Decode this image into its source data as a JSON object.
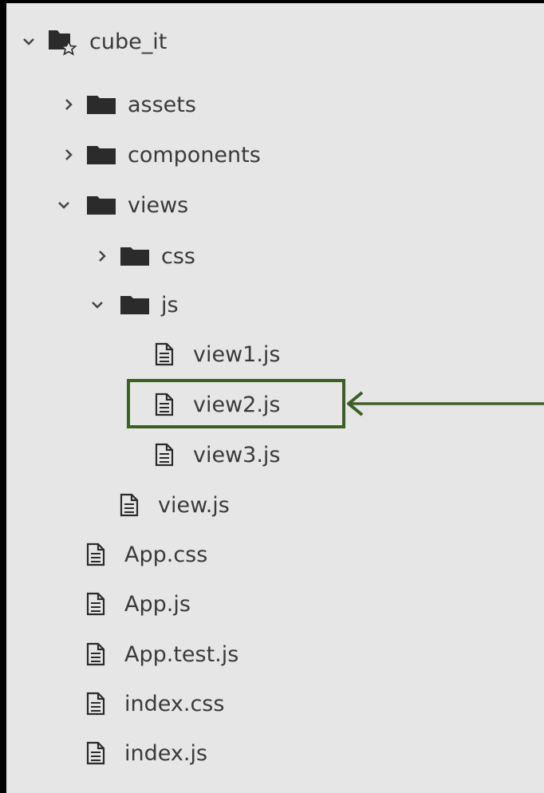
{
  "tree": {
    "root": {
      "label": "cube_it",
      "icon": "project-folder-icon",
      "expanded": true
    },
    "items": [
      {
        "label": "assets",
        "type": "folder",
        "expanded": false
      },
      {
        "label": "components",
        "type": "folder",
        "expanded": false
      },
      {
        "label": "views",
        "type": "folder",
        "expanded": true
      },
      {
        "label": "css",
        "type": "folder",
        "expanded": false
      },
      {
        "label": "js",
        "type": "folder",
        "expanded": true
      },
      {
        "label": "view1.js",
        "type": "file"
      },
      {
        "label": "view2.js",
        "type": "file",
        "highlighted": true
      },
      {
        "label": "view3.js",
        "type": "file"
      },
      {
        "label": "view.js",
        "type": "file"
      },
      {
        "label": "App.css",
        "type": "file"
      },
      {
        "label": "App.js",
        "type": "file"
      },
      {
        "label": "App.test.js",
        "type": "file"
      },
      {
        "label": "index.css",
        "type": "file"
      },
      {
        "label": "index.js",
        "type": "file"
      }
    ]
  },
  "annotation": {
    "type": "highlight-box-with-arrow",
    "target": "view2.js",
    "color": "#3d5f27"
  },
  "colors": {
    "panel": "#e6e6e6",
    "text": "#3a3a3a",
    "icon": "#2b2b2b"
  }
}
